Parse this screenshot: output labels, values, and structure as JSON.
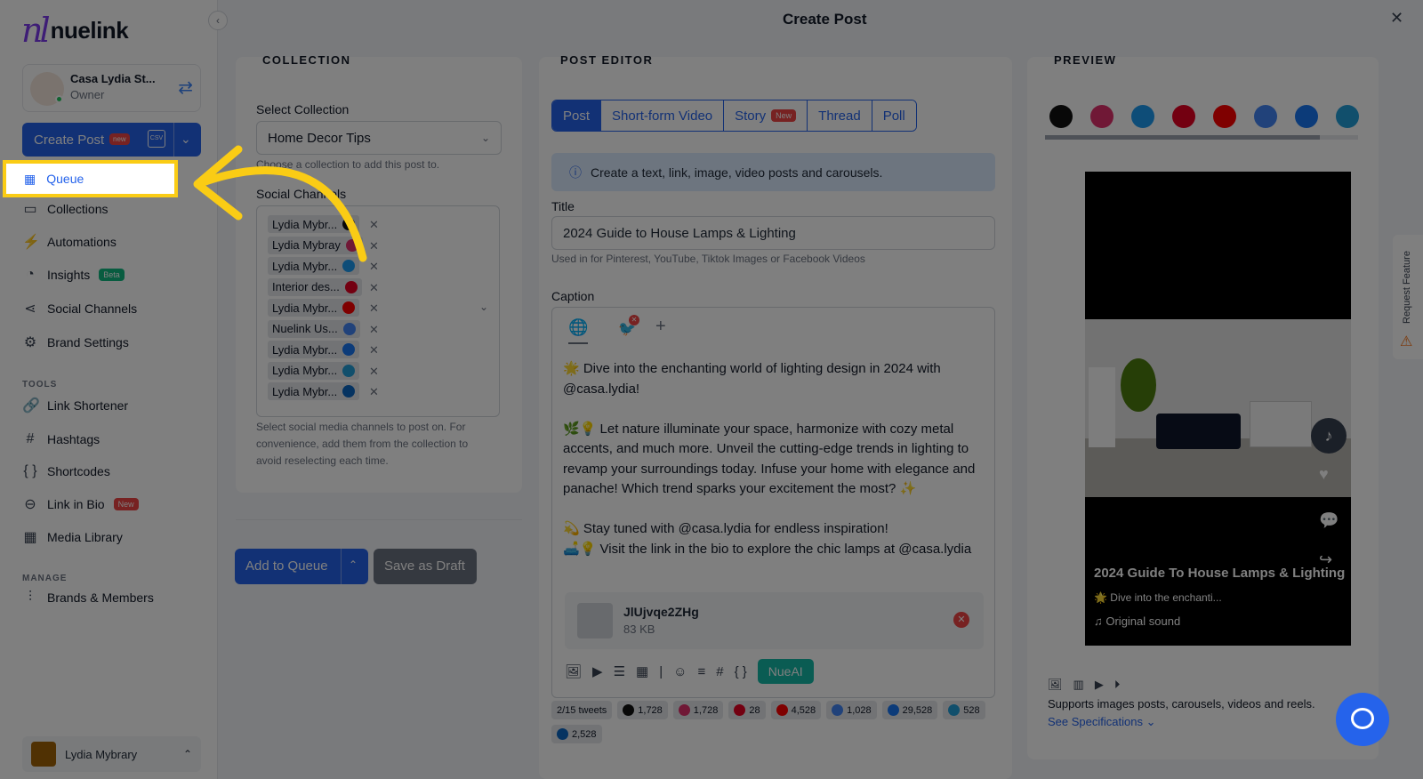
{
  "app": {
    "logo_text": "nuelink",
    "logo_mark": "nl",
    "modal_title": "Create Post"
  },
  "account": {
    "name": "Casa Lydia St...",
    "role": "Owner"
  },
  "create_post": {
    "label": "Create Post",
    "badge": "new",
    "csv": "CSV"
  },
  "nav": {
    "queue": "Queue",
    "collections": "Collections",
    "automations": "Automations",
    "insights": "Insights",
    "insights_badge": "Beta",
    "social_channels": "Social Channels",
    "brand_settings": "Brand Settings",
    "tools_header": "TOOLS",
    "link_shortener": "Link Shortener",
    "hashtags": "Hashtags",
    "shortcodes": "Shortcodes",
    "link_in_bio": "Link in Bio",
    "link_in_bio_badge": "New",
    "media_library": "Media Library",
    "manage_header": "MANAGE",
    "brands_members": "Brands & Members"
  },
  "user": {
    "name": "Lydia Mybrary"
  },
  "collection": {
    "header": "COLLECTION",
    "select_label": "Select Collection",
    "selected": "Home Decor Tips",
    "select_hint": "Choose a collection to add this post to.",
    "channels_label": "Social Channels",
    "channels": [
      {
        "name": "Lydia Mybr...",
        "color": "#111111"
      },
      {
        "name": "Lydia Mybray",
        "color": "#e1306c"
      },
      {
        "name": "Lydia Mybr...",
        "color": "#1d9bf0"
      },
      {
        "name": "Interior des...",
        "color": "#e60023"
      },
      {
        "name": "Lydia Mybr...",
        "color": "#ff0000"
      },
      {
        "name": "Nuelink Us...",
        "color": "#4285f4"
      },
      {
        "name": "Lydia Mybr...",
        "color": "#1877f2"
      },
      {
        "name": "Lydia Mybr...",
        "color": "#229ed9"
      },
      {
        "name": "Lydia Mybr...",
        "color": "#0a66c2"
      }
    ],
    "channels_hint": "Select social media channels to post on. For convenience, add them from the collection to avoid reselecting each time."
  },
  "actions": {
    "add_to_queue": "Add to Queue",
    "save_draft": "Save as Draft"
  },
  "editor": {
    "header": "POST EDITOR",
    "tabs": [
      "Post",
      "Short-form Video",
      "Story",
      "Thread",
      "Poll"
    ],
    "story_badge": "New",
    "info": "Create a text, link, image, video posts and carousels.",
    "title_label": "Title",
    "title_value": "2024 Guide to House Lamps & Lighting",
    "title_hint": "Used in for Pinterest, YouTube, Tiktok Images or Facebook Videos",
    "caption_label": "Caption",
    "caption_text": "🌟 Dive into the enchanting world of lighting design in 2024 with @casa.lydia!\n\n🌿💡 Let nature illuminate your space, harmonize with cozy metal accents, and much more. Unveil the cutting-edge trends in lighting to revamp your surroundings today. Infuse your home with elegance and panache! Which trend sparks your excitement the most? ✨\n\n💫 Stay tuned with @casa.lydia for endless inspiration!\n🛋️💡 Visit the link in the bio to explore the chic lamps at @casa.lydia",
    "attachment_name": "JlUjvqe2ZHg",
    "attachment_size": "83 KB",
    "nueai": "NueAI",
    "counts": [
      {
        "label": "2/15 tweets",
        "color": ""
      },
      {
        "label": "1,728",
        "color": "#111111"
      },
      {
        "label": "1,728",
        "color": "#e1306c"
      },
      {
        "label": "28",
        "color": "#e60023"
      },
      {
        "label": "4,528",
        "color": "#ff0000"
      },
      {
        "label": "1,028",
        "color": "#4285f4"
      },
      {
        "label": "29,528",
        "color": "#1877f2"
      },
      {
        "label": "528",
        "color": "#229ed9"
      },
      {
        "label": "2,528",
        "color": "#0a66c2"
      }
    ]
  },
  "preview": {
    "header": "PREVIEW",
    "platform_icons": [
      {
        "name": "tiktok-icon",
        "color": "#111111"
      },
      {
        "name": "instagram-icon",
        "color": "#e1306c"
      },
      {
        "name": "twitter-icon",
        "color": "#1d9bf0"
      },
      {
        "name": "pinterest-icon",
        "color": "#e60023"
      },
      {
        "name": "youtube-icon",
        "color": "#ff0000"
      },
      {
        "name": "google-business-icon",
        "color": "#4285f4"
      },
      {
        "name": "facebook-icon",
        "color": "#1877f2"
      },
      {
        "name": "telegram-icon",
        "color": "#229ed9"
      }
    ],
    "post_title": "2024 Guide To House Lamps & Lighting",
    "post_desc": "🌟 Dive into the enchanti...",
    "sound": "♫ Original sound",
    "supports": "Supports images posts, carousels, videos and reels.",
    "see_specs": "See Specifications ⌄"
  },
  "request_feature": "Request Feature"
}
